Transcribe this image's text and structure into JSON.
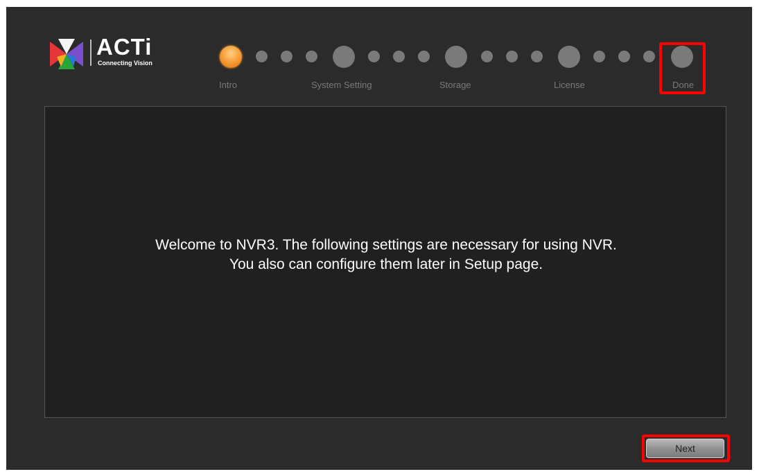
{
  "logo": {
    "brand": "ACTi",
    "tagline": "Connecting Vision"
  },
  "steps": [
    {
      "label": "Intro",
      "status": "active"
    },
    {
      "label": "System Setting",
      "status": "pending"
    },
    {
      "label": "Storage",
      "status": "pending"
    },
    {
      "label": "License",
      "status": "pending"
    },
    {
      "label": "Done",
      "status": "pending"
    }
  ],
  "main": {
    "welcome_line1": "Welcome to NVR3. The following settings are necessary for using NVR.",
    "welcome_line2": "You also can configure them later in Setup page."
  },
  "footer": {
    "next_label": "Next"
  },
  "colors": {
    "background": "#2b2b2b",
    "panel": "#202020",
    "active_step": "#f7a23a",
    "inactive_step": "#7a7a7a",
    "highlight": "#ff0000"
  },
  "icons": [
    "acti-logo-icon"
  ]
}
